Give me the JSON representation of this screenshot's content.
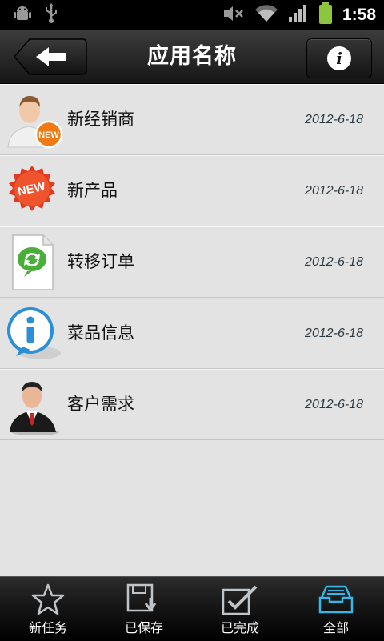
{
  "status_bar": {
    "time": "1:58"
  },
  "header": {
    "title": "应用名称"
  },
  "list": [
    {
      "label": "新经销商",
      "date": "2012-6-18",
      "icon": "new-dealer-person-icon",
      "badge": "NEW"
    },
    {
      "label": "新产品",
      "date": "2012-6-18",
      "icon": "new-badge-icon",
      "badge": "NEW"
    },
    {
      "label": "转移订单",
      "date": "2012-6-18",
      "icon": "transfer-document-icon"
    },
    {
      "label": "菜品信息",
      "date": "2012-6-18",
      "icon": "info-bubble-icon"
    },
    {
      "label": "客户需求",
      "date": "2012-6-18",
      "icon": "businessman-icon"
    }
  ],
  "tabs": [
    {
      "label": "新任务",
      "icon": "star-icon"
    },
    {
      "label": "已保存",
      "icon": "save-download-icon"
    },
    {
      "label": "已完成",
      "icon": "checkbox-done-icon"
    },
    {
      "label": "全部",
      "icon": "inbox-tray-icon",
      "active": true
    }
  ],
  "colors": {
    "active_tab": "#35b8e8",
    "badge_orange": "#f07a14",
    "badge_red": "#e23a1e"
  }
}
